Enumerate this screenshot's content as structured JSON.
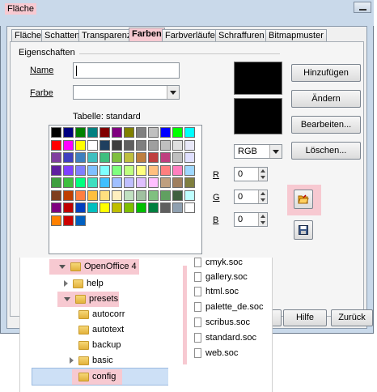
{
  "window": {
    "title": "Fläche"
  },
  "tabs": [
    {
      "label": "Fläche",
      "active": false
    },
    {
      "label": "Schatten",
      "active": false
    },
    {
      "label": "Transparenz",
      "active": false
    },
    {
      "label": "Farben",
      "active": true
    },
    {
      "label": "Farbverläufe",
      "active": false
    },
    {
      "label": "Schraffuren",
      "active": false
    },
    {
      "label": "Bitmapmuster",
      "active": false
    }
  ],
  "properties": {
    "group_label": "Eigenschaften",
    "name_label": "Name",
    "name_value": "",
    "color_label": "Farbe",
    "color_value": "",
    "table_label": "Tabelle: standard"
  },
  "palette": {
    "colors": [
      [
        "#000000",
        "#000080",
        "#008000",
        "#008080",
        "#800000",
        "#800080",
        "#808000",
        "#808080",
        "#c0c0c0",
        "#0000ff",
        "#00ff00",
        "#00ffff"
      ],
      [
        "#ff0000",
        "#ff00ff",
        "#ffff00",
        "#ffffff",
        "#1f3f5f",
        "#3f3f3f",
        "#5f5f5f",
        "#7f7f7f",
        "#9f9f9f",
        "#bfbfbf",
        "#dfdfdf",
        "#e8e8f8"
      ],
      [
        "#7f3f9f",
        "#3f3fbf",
        "#3f7fbf",
        "#3fbfbf",
        "#3fbf7f",
        "#7fbf3f",
        "#bfbf3f",
        "#bf7f3f",
        "#bf3f3f",
        "#bf3f7f",
        "#bfbfbf",
        "#e0e0ff"
      ],
      [
        "#5f1f9f",
        "#7f3fff",
        "#7f7fff",
        "#7fbfff",
        "#7fffff",
        "#7fff7f",
        "#bfff7f",
        "#ffff7f",
        "#ffbf7f",
        "#ff7f7f",
        "#ff7fbf",
        "#9fd8ff"
      ],
      [
        "#3f9f3f",
        "#3fbf3f",
        "#00ff7f",
        "#3fdfbf",
        "#3fbfff",
        "#9fbfff",
        "#bfbfff",
        "#dfbfff",
        "#ffbfff",
        "#bf9f7f",
        "#9f7f5f",
        "#7f7f3f"
      ],
      [
        "#7f3f1f",
        "#bf3f00",
        "#ff7f3f",
        "#ffbf3f",
        "#ffdf7f",
        "#ffefbf",
        "#c0e0c0",
        "#a0c0a0",
        "#80c080",
        "#60a060",
        "#406040",
        "#bfffff"
      ],
      [
        "#7f007f",
        "#bf0000",
        "#003fbf",
        "#00bfbf",
        "#ffff00",
        "#bfbf00",
        "#7fbf00",
        "#00bf00",
        "#007f3f",
        "#5f5f5f",
        "#8fa0b0",
        "#ffffff"
      ],
      [
        "#ff8000",
        "#cc0000",
        "#0060c0"
      ]
    ]
  },
  "buttons": {
    "add": "Hinzufügen",
    "change": "Ändern",
    "edit": "Bearbeiten...",
    "delete": "Löschen..."
  },
  "color_model": {
    "selected": "RGB",
    "r_label": "R",
    "g_label": "G",
    "b_label": "B",
    "r_value": "0",
    "g_value": "0",
    "b_value": "0"
  },
  "icons": {
    "open": "open-folder-icon",
    "save": "save-icon"
  },
  "bottom_buttons": {
    "help": "Hilfe",
    "back": "Zurück"
  },
  "folder_tree": [
    {
      "label": "OpenOffice 4",
      "expanded": true,
      "highlighted": true
    },
    {
      "label": "help",
      "expanded": false,
      "highlighted": false
    },
    {
      "label": "presets",
      "expanded": true,
      "highlighted": true
    },
    {
      "label": "autocorr",
      "expanded": null,
      "highlighted": false
    },
    {
      "label": "autotext",
      "expanded": null,
      "highlighted": false
    },
    {
      "label": "backup",
      "expanded": null,
      "highlighted": false
    },
    {
      "label": "basic",
      "expanded": false,
      "highlighted": false
    },
    {
      "label": "config",
      "expanded": null,
      "highlighted": true,
      "selected": true
    }
  ],
  "file_list": [
    "cmyk.soc",
    "gallery.soc",
    "html.soc",
    "palette_de.soc",
    "scribus.soc",
    "standard.soc",
    "web.soc"
  ]
}
